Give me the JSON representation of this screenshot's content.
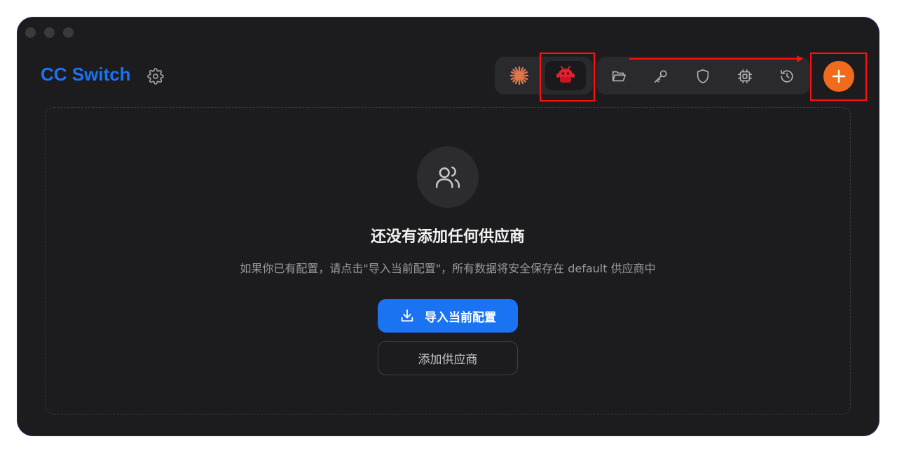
{
  "app": {
    "title": "CC Switch"
  },
  "header": {
    "apps": [
      {
        "name": "claude",
        "icon": "claude-starburst-icon",
        "color": "#e0764a",
        "active": false
      },
      {
        "name": "codex",
        "icon": "red-robot-icon",
        "color": "#e0202e",
        "active": true
      }
    ],
    "tools": [
      {
        "icon": "folder-open-icon"
      },
      {
        "icon": "key-icon"
      },
      {
        "icon": "shield-icon"
      },
      {
        "icon": "cpu-chip-icon"
      },
      {
        "icon": "history-icon"
      }
    ],
    "add_button": {
      "icon": "plus-icon",
      "color": "#f26b1d"
    }
  },
  "empty_state": {
    "icon": "users-icon",
    "title": "还没有添加任何供应商",
    "description": "如果你已有配置，请点击\"导入当前配置\"，所有数据将安全保存在 default 供应商中",
    "import_button": "导入当前配置",
    "add_provider_button": "添加供应商"
  },
  "colors": {
    "accent": "#1a73f2",
    "window_bg": "#1c1c1f",
    "annotation": "#ff1010"
  }
}
